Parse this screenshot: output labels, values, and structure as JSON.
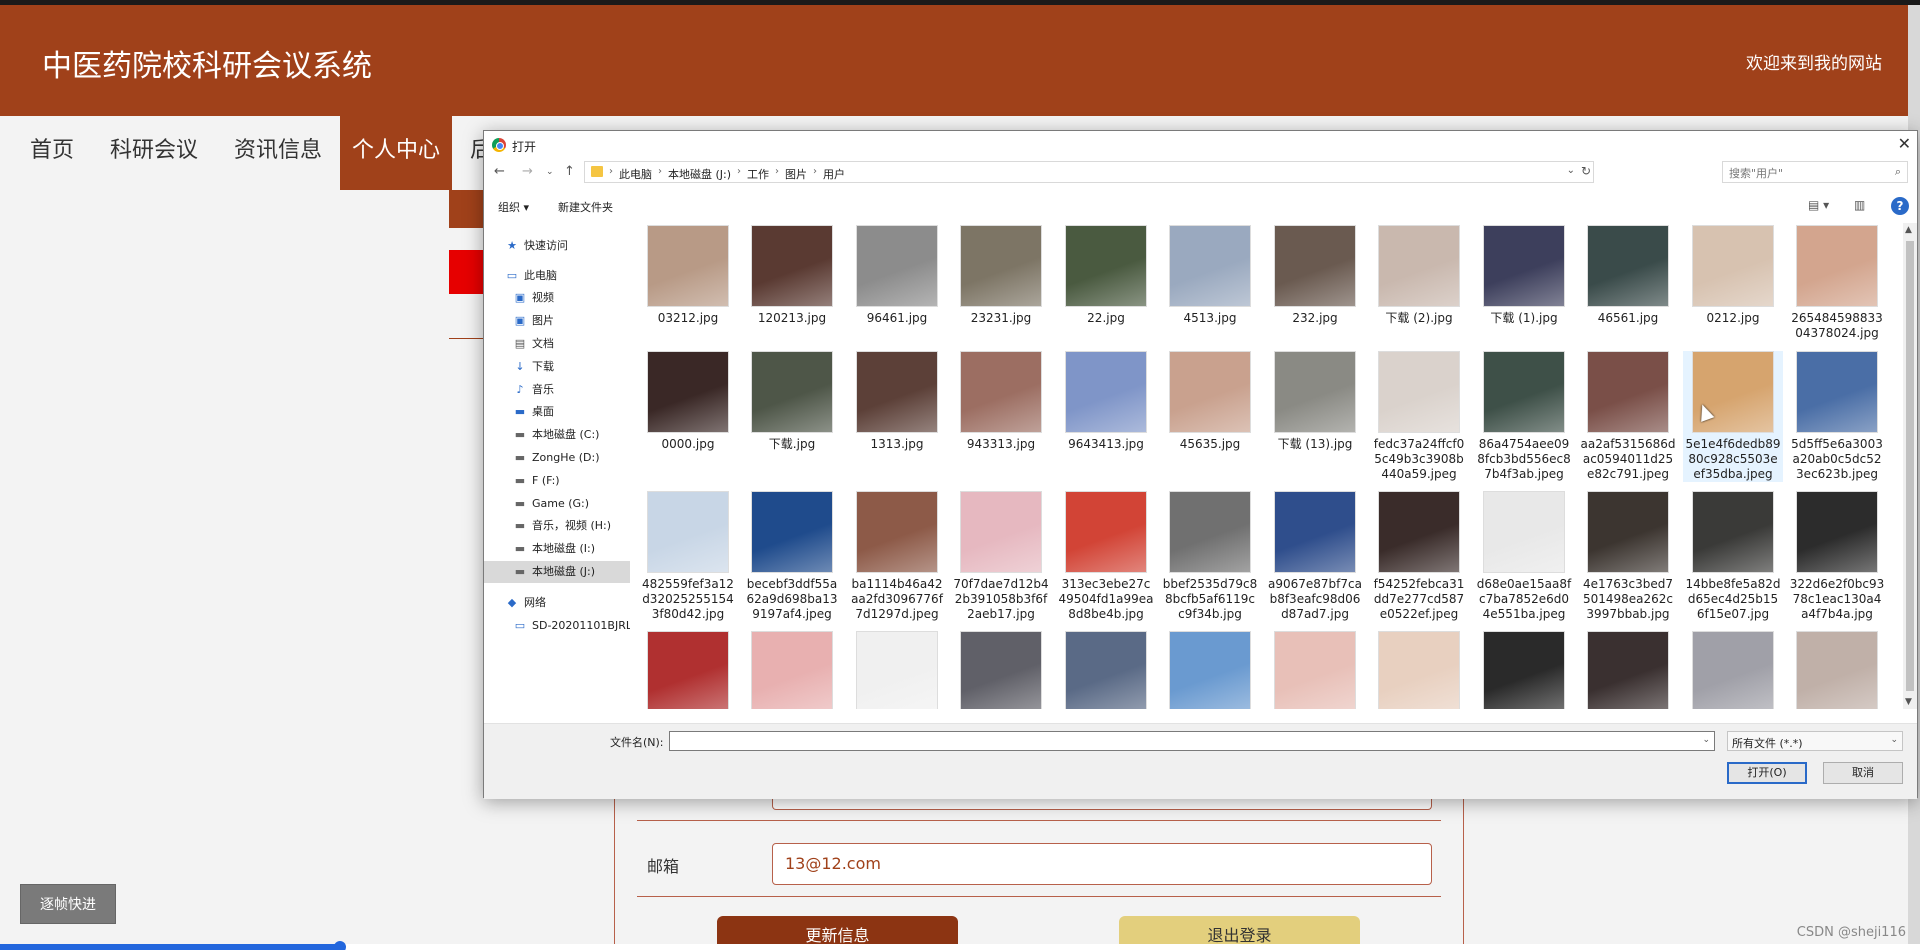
{
  "site": {
    "title": "中医药院校科研会议系统",
    "welcome": "欢迎来到我的网站",
    "nav": [
      "首页",
      "科研会议",
      "资讯信息",
      "个人中心",
      "后台管"
    ],
    "active_nav": "个人中心"
  },
  "profile": {
    "email_label": "邮箱",
    "email_value": "13@12.com",
    "update_button": "更新信息",
    "logout_button": "退出登录"
  },
  "player": {
    "frame_step": "逐帧快进",
    "progress": 0.177,
    "watermark": "CSDN @sheji116"
  },
  "dialog": {
    "title": "打开",
    "close": "✕",
    "breadcrumbs": [
      "此电脑",
      "本地磁盘 (J:)",
      "工作",
      "图片",
      "用户"
    ],
    "search_placeholder": "搜索\"用户\"",
    "toolbar": {
      "organize": "组织 ▾",
      "new_folder": "新建文件夹"
    },
    "tree": [
      {
        "label": "快速访问",
        "icon": "star-icon",
        "indent": 1
      },
      {
        "label": "此电脑",
        "icon": "computer-icon",
        "indent": 1
      },
      {
        "label": "视频",
        "icon": "video-icon",
        "indent": 2
      },
      {
        "label": "图片",
        "icon": "picture-icon",
        "indent": 2
      },
      {
        "label": "文档",
        "icon": "document-icon",
        "indent": 2
      },
      {
        "label": "下载",
        "icon": "download-icon",
        "indent": 2
      },
      {
        "label": "音乐",
        "icon": "music-icon",
        "indent": 2
      },
      {
        "label": "桌面",
        "icon": "desktop-icon",
        "indent": 2
      },
      {
        "label": "本地磁盘 (C:)",
        "icon": "drive-icon",
        "indent": 2
      },
      {
        "label": "ZongHe (D:)",
        "icon": "drive-icon",
        "indent": 2
      },
      {
        "label": "F (F:)",
        "icon": "drive-icon",
        "indent": 2
      },
      {
        "label": "Game (G:)",
        "icon": "drive-icon",
        "indent": 2
      },
      {
        "label": "音乐，视频 (H:)",
        "icon": "drive-icon",
        "indent": 2
      },
      {
        "label": "本地磁盘 (I:)",
        "icon": "drive-icon",
        "indent": 2
      },
      {
        "label": "本地磁盘 (J:)",
        "icon": "drive-icon",
        "indent": 2,
        "selected": true
      },
      {
        "label": "网络",
        "icon": "network-icon",
        "indent": 1
      },
      {
        "label": "SD-20201101BJRL",
        "icon": "monitor-icon",
        "indent": 2
      }
    ],
    "files": [
      {
        "name": "03212.jpg",
        "color": "#b89a86"
      },
      {
        "name": "120213.jpg",
        "color": "#5a3a32"
      },
      {
        "name": "96461.jpg",
        "color": "#8c8c8c"
      },
      {
        "name": "23231.jpg",
        "color": "#7d7565"
      },
      {
        "name": "22.jpg",
        "color": "#4a5a40"
      },
      {
        "name": "4513.jpg",
        "color": "#9aa9bf"
      },
      {
        "name": "232.jpg",
        "color": "#6a5a50"
      },
      {
        "name": "下载 (2).jpg",
        "color": "#c9b8ae"
      },
      {
        "name": "下载 (1).jpg",
        "color": "#3d3f5c"
      },
      {
        "name": "46561.jpg",
        "color": "#3a4b4a"
      },
      {
        "name": "0212.jpg",
        "color": "#d7c2b0"
      },
      {
        "name": "26548459883304378024.jpg",
        "color": "#d3a58e"
      },
      {
        "name": "0000.jpg",
        "color": "#3a2826"
      },
      {
        "name": "下载.jpg",
        "color": "#4e5648"
      },
      {
        "name": "1313.jpg",
        "color": "#5c4038"
      },
      {
        "name": "943313.jpg",
        "color": "#9c6e62"
      },
      {
        "name": "9643413.jpg",
        "color": "#7f95c8"
      },
      {
        "name": "45635.jpg",
        "color": "#c9a18e"
      },
      {
        "name": "下载 (13).jpg",
        "color": "#8a8a84"
      },
      {
        "name": "fedc37a24ffcf05c49b3c3908b440a59.jpeg",
        "color": "#dad2cc"
      },
      {
        "name": "86a4754aee098fcb3bd556ec87b4f3ab.jpeg",
        "color": "#3e5048"
      },
      {
        "name": "aa2af5315686dac0594011d25e82c791.jpeg",
        "color": "#7a4f48"
      },
      {
        "name": "5e1e4f6dedb8980c928c5503eef35dba.jpeg",
        "color": "#d6a46e",
        "selected": true
      },
      {
        "name": "5d5ff5e6a3003a20ab0c5dc523ec623b.jpeg",
        "color": "#4a6ea6"
      },
      {
        "name": "482559fef3a12d320252551543f80d42.jpg",
        "color": "#c8d6e6"
      },
      {
        "name": "becebf3ddf55a62a9d698ba139197af4.jpeg",
        "color": "#1f4b8c"
      },
      {
        "name": "ba1114b46a42aa2fd3096776f7d1297d.jpeg",
        "color": "#8d5a48"
      },
      {
        "name": "70f7dae7d12b42b391058b3f6f2aeb17.jpg",
        "color": "#e6b8c0"
      },
      {
        "name": "313ec3ebe27c49504fd1a99ea8d8be4b.jpg",
        "color": "#d24436"
      },
      {
        "name": "bbef2535d79c88bcfb5af6119cc9f34b.jpg",
        "color": "#707070"
      },
      {
        "name": "a9067e87bf7cab8f3eafc98d06d87ad7.jpg",
        "color": "#2f4e8c"
      },
      {
        "name": "f54252febca31dd7e277cd587e0522ef.jpeg",
        "color": "#3a2c2a"
      },
      {
        "name": "d68e0ae15aa8fc7ba7852e6d04e551ba.jpeg",
        "color": "#e8e8e8"
      },
      {
        "name": "4e1763c3bed7501498ea262c3997bbab.jpg",
        "color": "#3c3530"
      },
      {
        "name": "14bbe8fe5a82dd65ec4d25b156f15e07.jpg",
        "color": "#3a3a38"
      },
      {
        "name": "322d6e2f0bc9378c1eac130a4a4f7b4a.jpg",
        "color": "#2c2c2c"
      },
      {
        "name": "",
        "color": "#b03030"
      },
      {
        "name": "",
        "color": "#e8b0b0"
      },
      {
        "name": "",
        "color": "#f0f0f0"
      },
      {
        "name": "",
        "color": "#606068"
      },
      {
        "name": "",
        "color": "#5a6a86"
      },
      {
        "name": "",
        "color": "#6a9ad0"
      },
      {
        "name": "",
        "color": "#e8c0b8"
      },
      {
        "name": "",
        "color": "#e8d0c0"
      },
      {
        "name": "",
        "color": "#2a2a2a"
      },
      {
        "name": "",
        "color": "#3a3030"
      },
      {
        "name": "",
        "color": "#a0a0a8"
      },
      {
        "name": "",
        "color": "#c0b0a8"
      }
    ],
    "filename_label": "文件名(N):",
    "filename_value": "",
    "filetype": "所有文件 (*.*)",
    "open_button": "打开(O)",
    "cancel_button": "取消"
  }
}
